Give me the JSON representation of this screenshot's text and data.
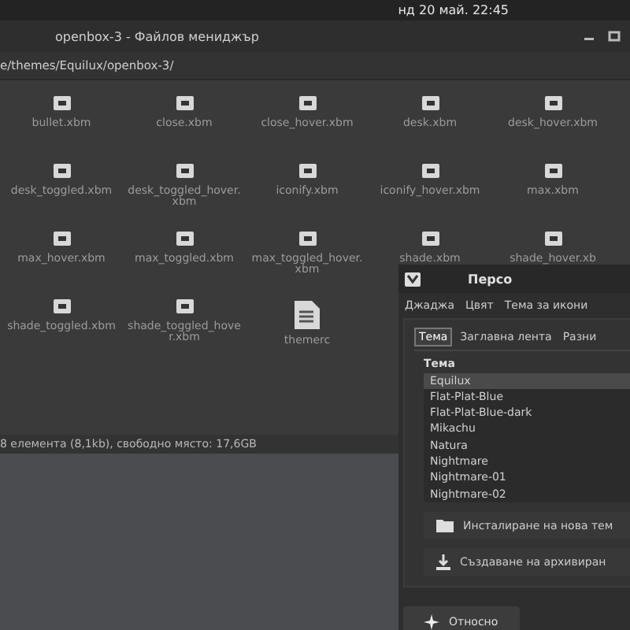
{
  "top_panel": {
    "clock": "нд 20 май. 22:45"
  },
  "file_manager": {
    "title": "openbox-3 - Файлов мениджър",
    "path": "e/themes/Equilux/openbox-3/",
    "files": [
      {
        "name": "bullet.xbm",
        "kind": "bitmap"
      },
      {
        "name": "close.xbm",
        "kind": "bitmap"
      },
      {
        "name": "close_hover.xbm",
        "kind": "bitmap"
      },
      {
        "name": "desk.xbm",
        "kind": "bitmap"
      },
      {
        "name": "desk_hover.xbm",
        "kind": "bitmap"
      },
      {
        "name": "desk_toggled.xbm",
        "kind": "bitmap"
      },
      {
        "name": "desk_toggled_hover.xbm",
        "kind": "bitmap"
      },
      {
        "name": "iconify.xbm",
        "kind": "bitmap"
      },
      {
        "name": "iconify_hover.xbm",
        "kind": "bitmap"
      },
      {
        "name": "max.xbm",
        "kind": "bitmap"
      },
      {
        "name": "max_hover.xbm",
        "kind": "bitmap"
      },
      {
        "name": "max_toggled.xbm",
        "kind": "bitmap"
      },
      {
        "name": "max_toggled_hover.xbm",
        "kind": "bitmap"
      },
      {
        "name": "shade.xbm",
        "kind": "bitmap"
      },
      {
        "name": "shade_hover.xb",
        "kind": "bitmap"
      },
      {
        "name": "shade_toggled.xbm",
        "kind": "bitmap"
      },
      {
        "name": "shade_toggled_hover.xbm",
        "kind": "bitmap"
      },
      {
        "name": "themerc",
        "kind": "text"
      }
    ],
    "status_bar": "8 елемента (8,1kb), свободно място: 17,6GB"
  },
  "dialog": {
    "title": "Персо",
    "tabs": [
      {
        "label": "Джаджа",
        "selected": false
      },
      {
        "label": "Цвят",
        "selected": false
      },
      {
        "label": "Тема за икони",
        "selected": false
      }
    ],
    "subtabs": [
      {
        "label": "Тема",
        "selected": true
      },
      {
        "label": "Заглавна лента",
        "selected": false
      },
      {
        "label": "Разни",
        "selected": false
      }
    ],
    "list_label": "Тема",
    "themes": [
      {
        "name": "Equilux",
        "selected": true
      },
      {
        "name": "Flat-Plat-Blue",
        "selected": false
      },
      {
        "name": "Flat-Plat-Blue-dark",
        "selected": false
      },
      {
        "name": "Mikachu",
        "selected": false
      },
      {
        "name": "Natura",
        "selected": false
      },
      {
        "name": "Nightmare",
        "selected": false
      },
      {
        "name": "Nightmare-01",
        "selected": false
      },
      {
        "name": "Nightmare-02",
        "selected": false
      }
    ],
    "install_button": "Инсталиране на нова тем",
    "archive_button": "Създаване на архивиран",
    "about_button": "Относно"
  }
}
